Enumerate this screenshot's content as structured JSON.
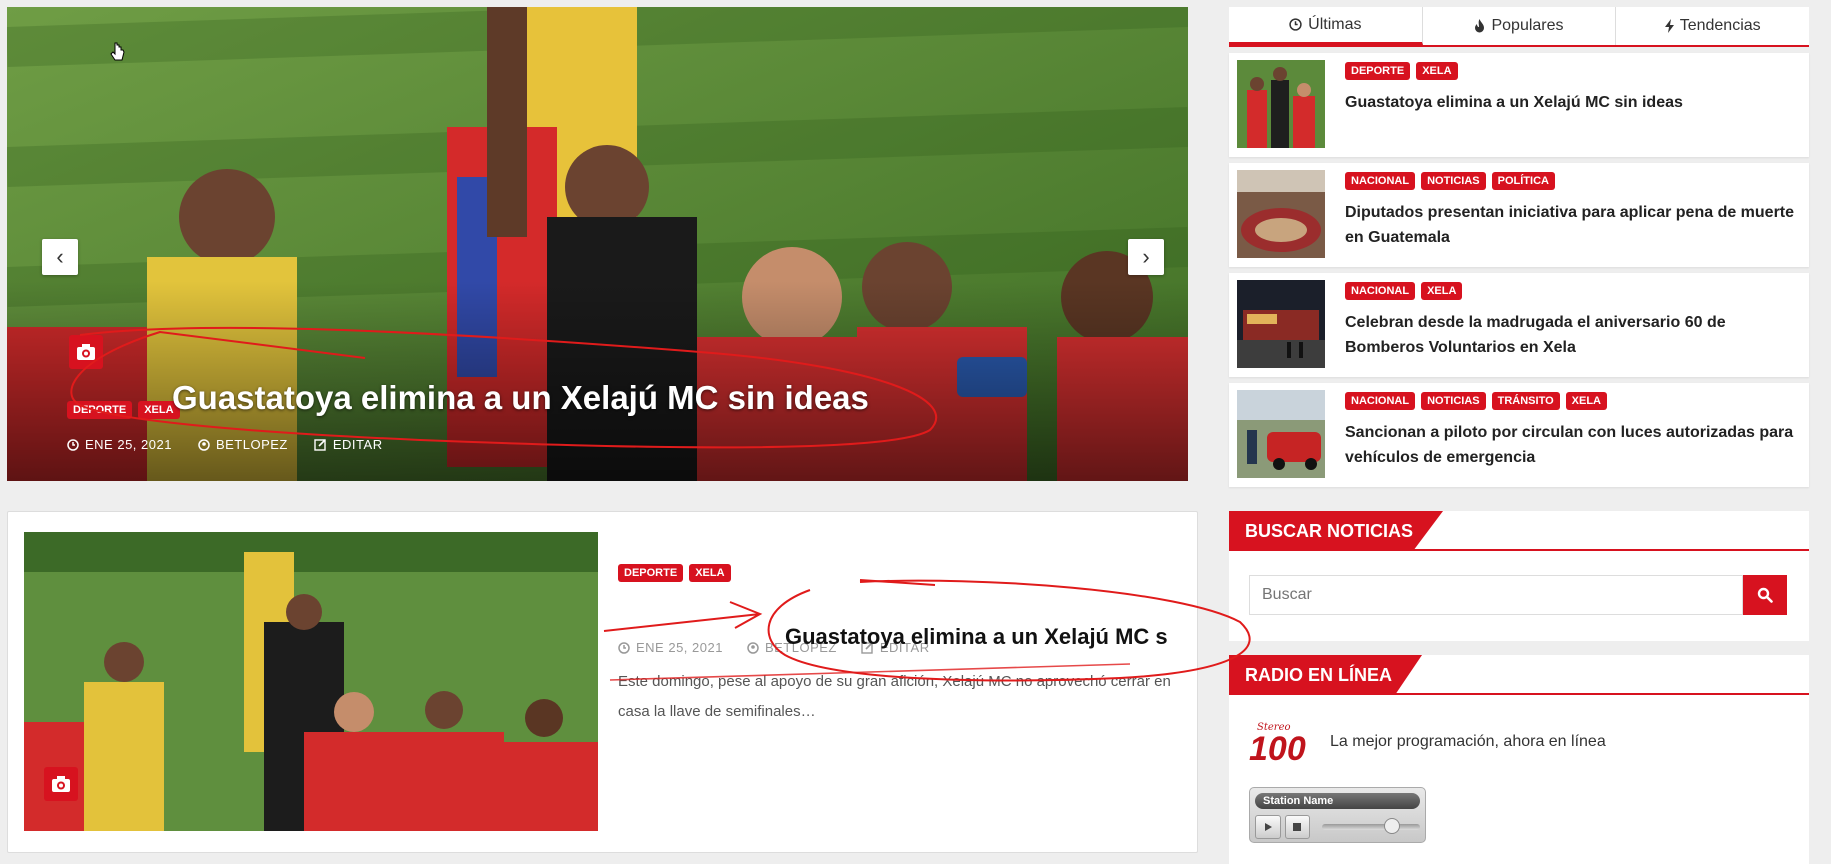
{
  "hero": {
    "categories": [
      "DEPORTE",
      "XELA"
    ],
    "title": "Guastatoya elimina a un Xelajú MC sin ideas",
    "date": "ENE 25, 2021",
    "author": "BETLOPEZ",
    "edit_label": "EDITAR",
    "prev_icon": "chevron-left-icon",
    "next_icon": "chevron-right-icon"
  },
  "tabs": [
    {
      "label": "Últimas",
      "icon": "clock-icon",
      "active": true
    },
    {
      "label": "Populares",
      "icon": "fire-icon",
      "active": false
    },
    {
      "label": "Tendencias",
      "icon": "bolt-icon",
      "active": false
    }
  ],
  "posts": [
    {
      "categories": [
        "DEPORTE",
        "XELA"
      ],
      "title": "Guastatoya elimina a un Xelajú MC sin ideas"
    },
    {
      "categories": [
        "NACIONAL",
        "NOTICIAS",
        "POLÍTICA"
      ],
      "title": "Diputados presentan iniciativa para aplicar pena de muerte en Guatemala"
    },
    {
      "categories": [
        "NACIONAL",
        "XELA"
      ],
      "title": "Celebran desde la madrugada el aniversario 60 de Bomberos Voluntarios en Xela"
    },
    {
      "categories": [
        "NACIONAL",
        "NOTICIAS",
        "TRÁNSITO",
        "XELA"
      ],
      "title": "Sancionan a piloto por circulan con luces autorizadas para vehículos de emergencia"
    }
  ],
  "featured": {
    "categories": [
      "DEPORTE",
      "XELA"
    ],
    "title": "Guastatoya elimina a un Xelajú MC s",
    "date": "ENE 25, 2021",
    "author": "BETLOPEZ",
    "edit_label": "EDITAR",
    "excerpt": "Este domingo, pese al apoyo de su gran afición, Xelajú MC no aprovechó cerrar en casa la llave de semifinales…"
  },
  "search_widget": {
    "title": "BUSCAR NOTICIAS",
    "placeholder": "Buscar"
  },
  "radio_widget": {
    "title": "RADIO EN LÍNEA",
    "logo_text": "Stereo 100",
    "tagline": "La mejor programación, ahora en línea",
    "station_name": "Station Name",
    "volume": 0.7
  },
  "colors": {
    "accent": "#d7121f",
    "background": "#eeeeee",
    "annotation": "#e01b1b"
  }
}
